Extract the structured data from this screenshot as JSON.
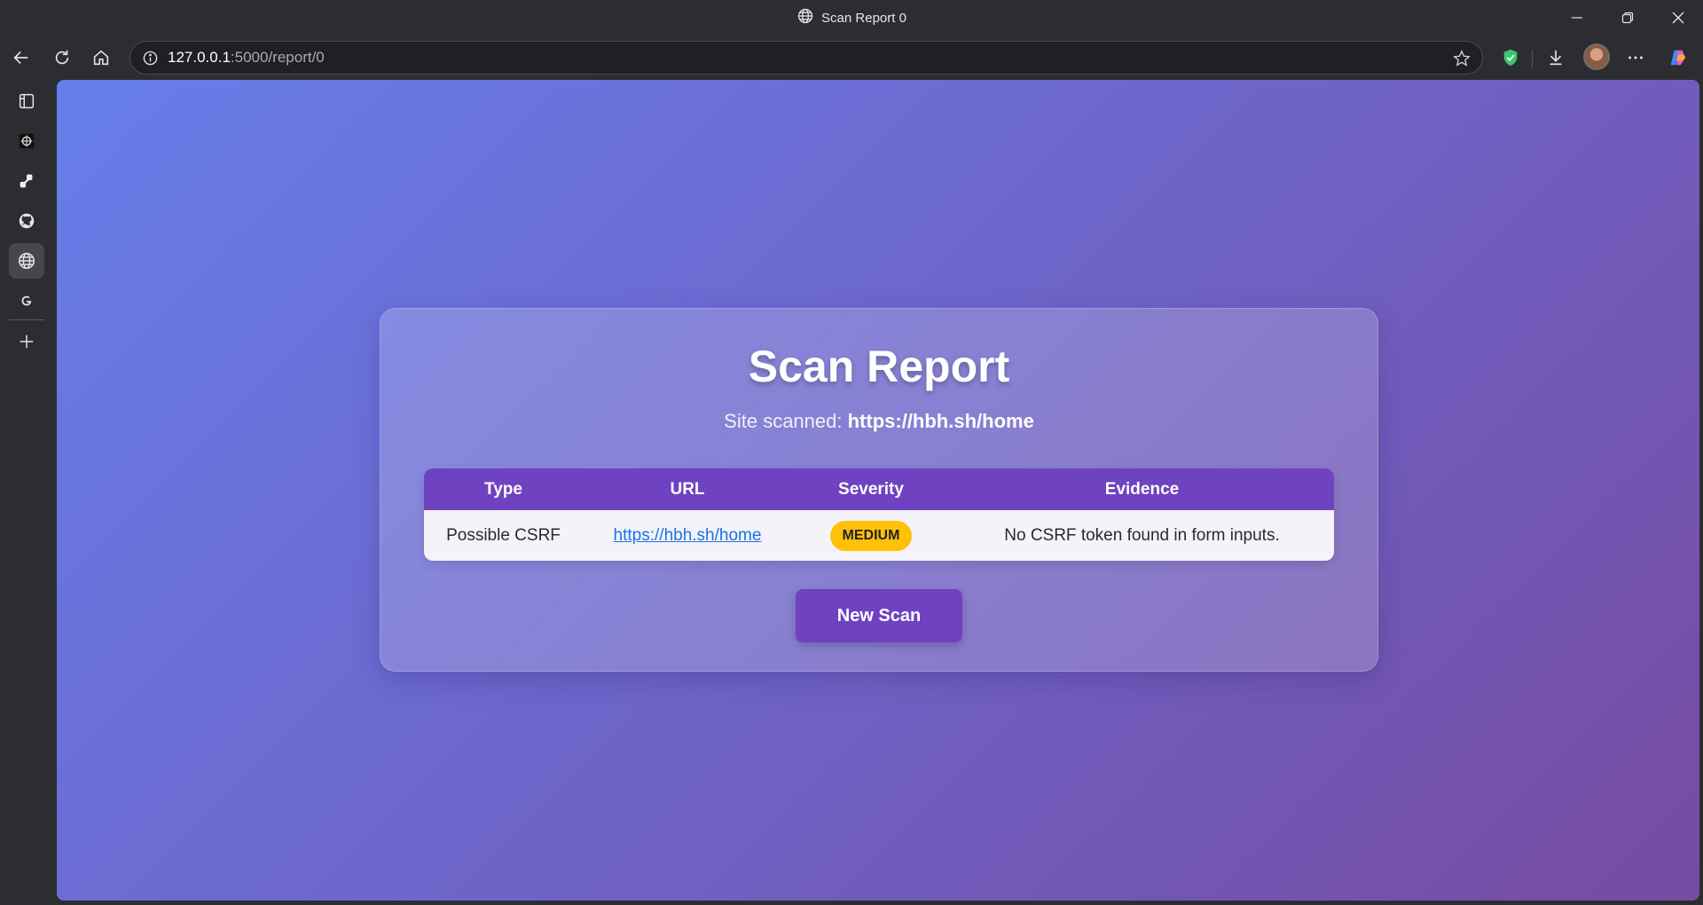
{
  "window": {
    "title": "Scan Report 0",
    "icons": {
      "title": "globe-icon",
      "minimize": "minimize-icon",
      "restore": "restore-icon",
      "close": "close-icon"
    }
  },
  "toolbar": {
    "address_host": "127.0.0.1",
    "address_path": ":5000/report/0",
    "icons": [
      "back-icon",
      "reload-icon",
      "home-icon",
      "site-info-icon",
      "favorite-star-icon",
      "shield-extension-icon",
      "download-icon",
      "profile-avatar",
      "more-icon",
      "copilot-icon"
    ]
  },
  "sidebar": {
    "items": [
      "tab-actions-icon",
      "app-icon-1",
      "app-icon-2",
      "github-icon",
      "globe-icon",
      "google-icon",
      "add-icon"
    ]
  },
  "page": {
    "heading": "Scan Report",
    "subtitle_prefix": "Site scanned: ",
    "site_url": "https://hbh.sh/home",
    "table": {
      "headers": {
        "type": "Type",
        "url": "URL",
        "severity": "Severity",
        "evidence": "Evidence"
      },
      "rows": [
        {
          "type": "Possible CSRF",
          "url": "https://hbh.sh/home",
          "severity": "MEDIUM",
          "evidence": "No CSRF token found in form inputs."
        }
      ]
    },
    "new_scan_label": "New Scan"
  },
  "colors": {
    "gradient_start": "#667eea",
    "gradient_end": "#764ba2",
    "accent": "#6f42c1",
    "badge_medium": "#ffc107",
    "link": "#1a73e8"
  }
}
